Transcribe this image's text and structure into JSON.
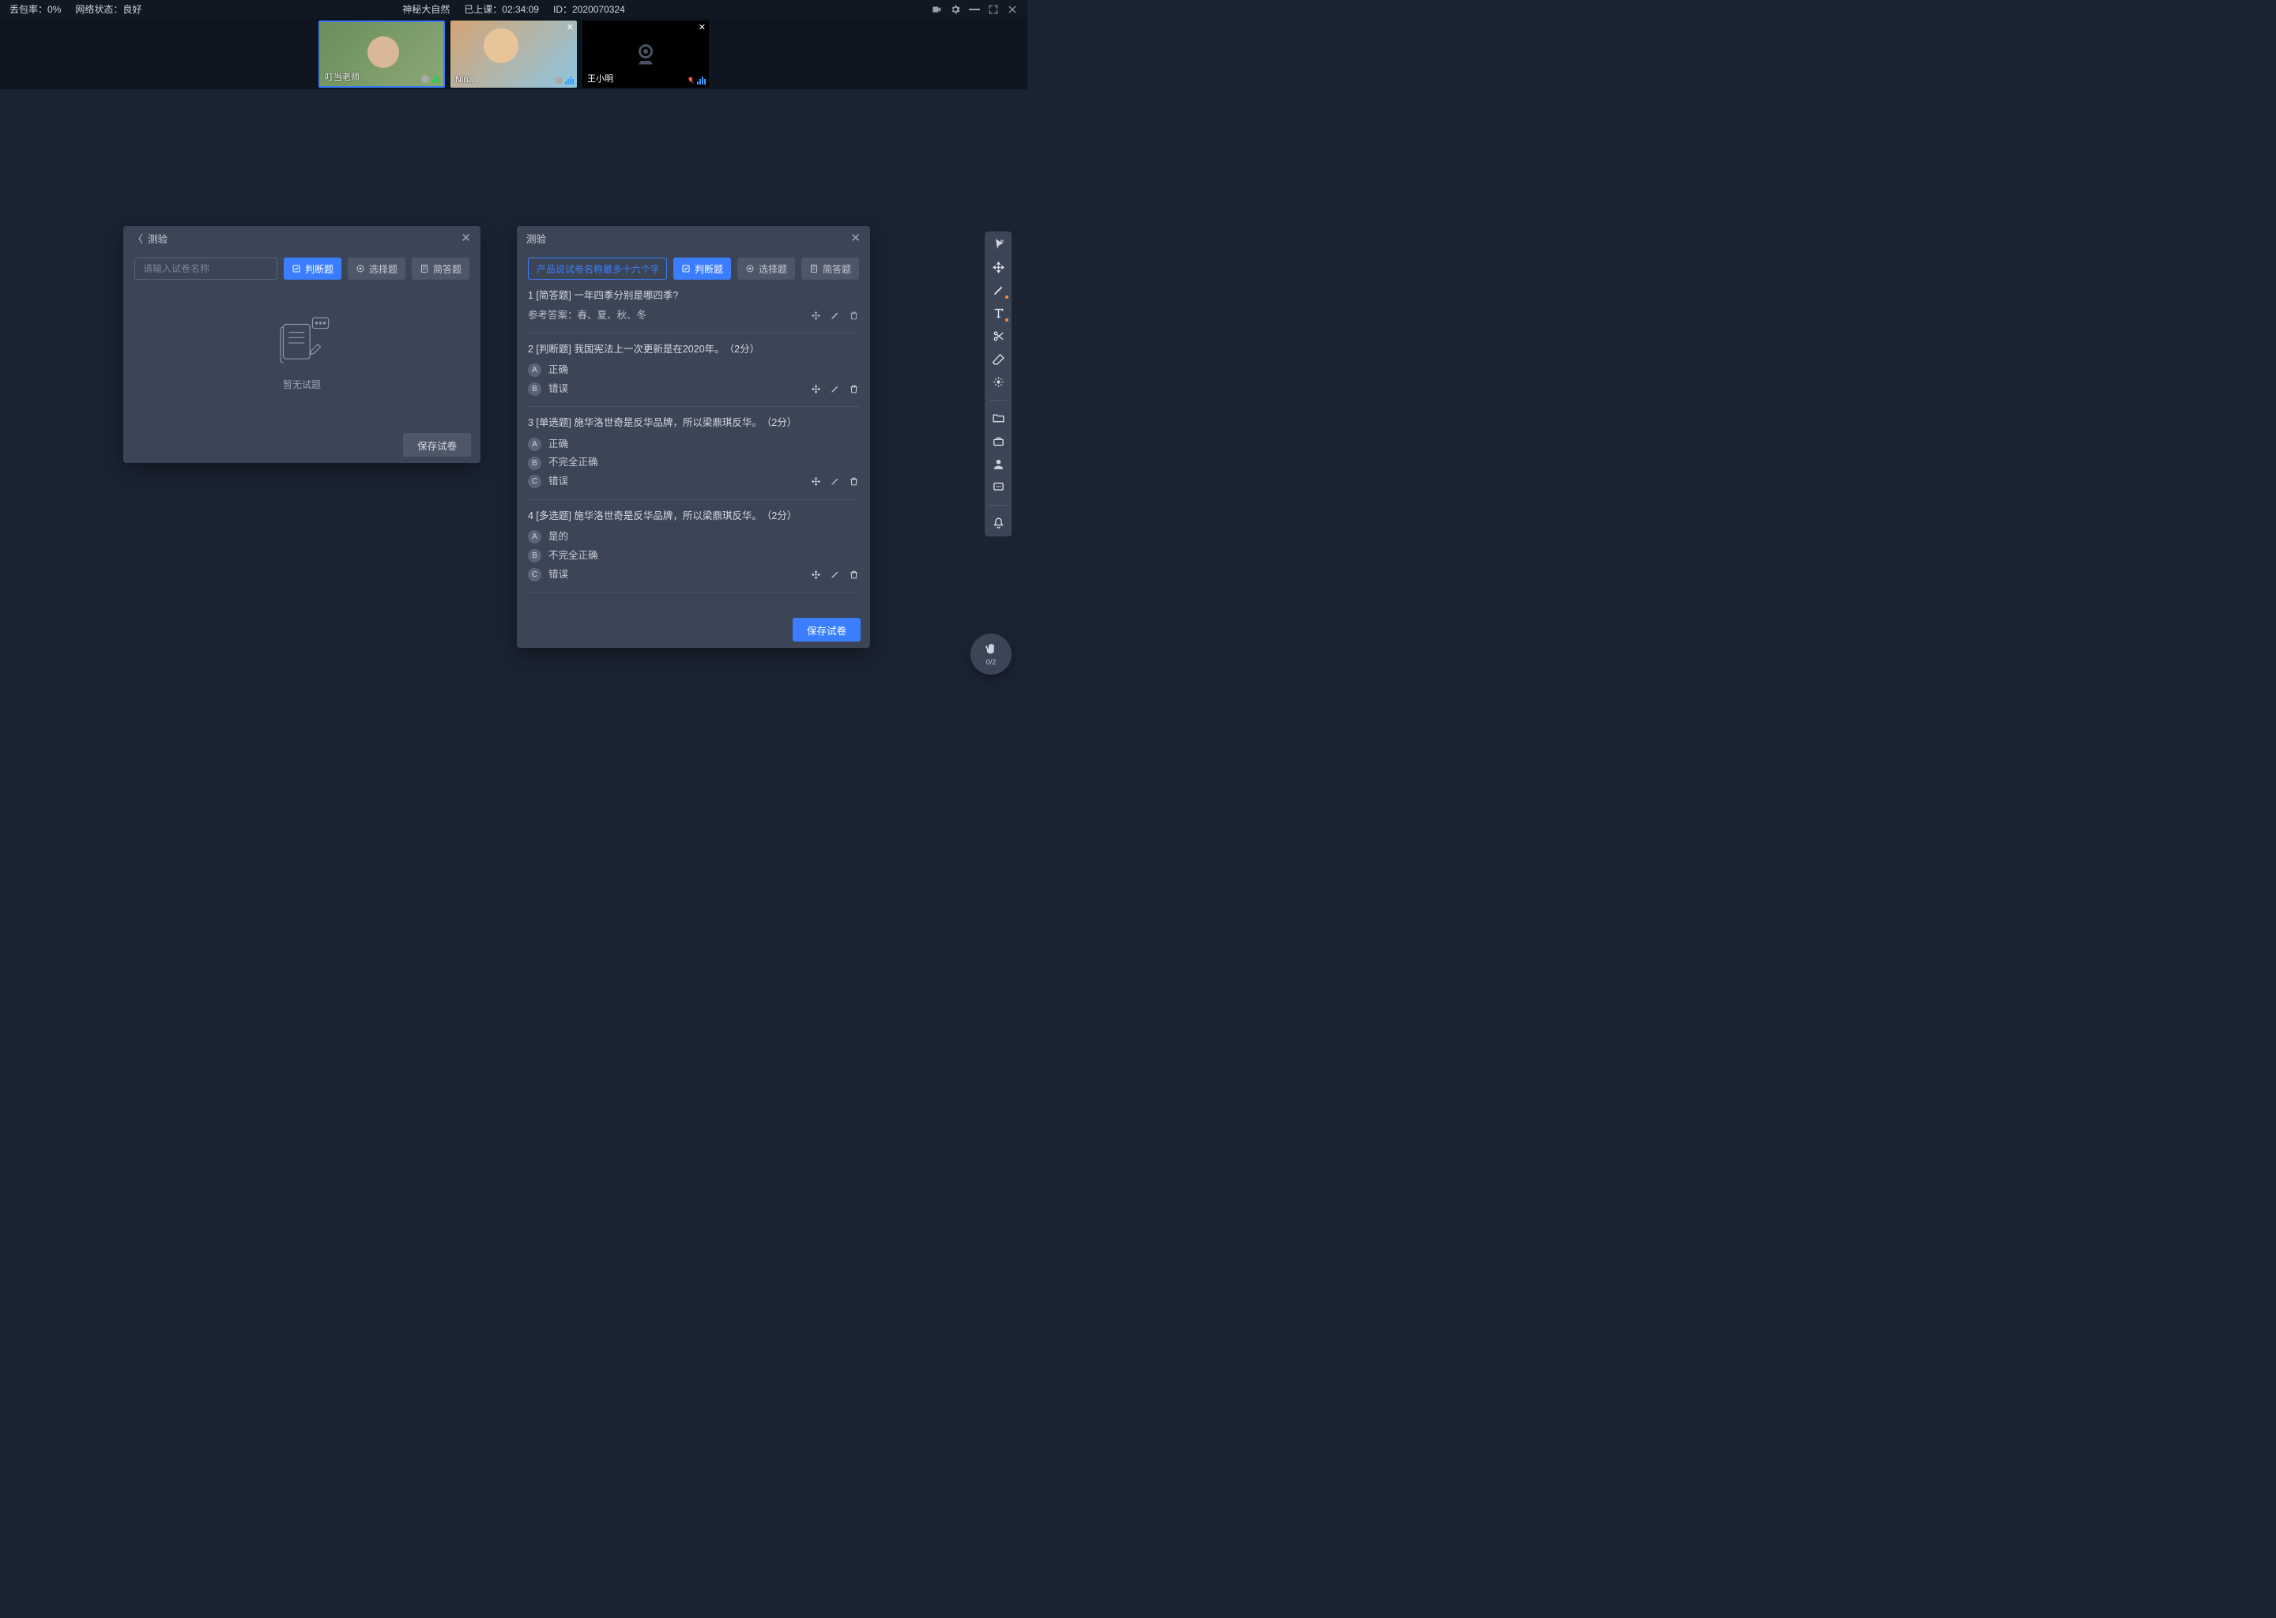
{
  "topbar": {
    "loss_rate_label": "丢包率：",
    "loss_rate_value": "0%",
    "network_label": "网络状态：",
    "network_value": "良好",
    "lesson_title": "神秘大自然",
    "duration_label": "已上课：",
    "duration_value": "02:34:09",
    "id_label": "ID：",
    "id_value": "2020070324"
  },
  "participants": [
    {
      "name": "叮当老师",
      "role": "teacher",
      "camera": "on"
    },
    {
      "name": "Nina",
      "role": "student",
      "camera": "on"
    },
    {
      "name": "王小明",
      "role": "student",
      "camera": "off"
    }
  ],
  "panelLeft": {
    "title": "测验",
    "name_placeholder": "请输入试卷名称",
    "btn_judge": "判断题",
    "btn_choice": "选择题",
    "btn_short": "简答题",
    "empty_text": "暂无试题",
    "save": "保存试卷"
  },
  "panelRight": {
    "title": "测验",
    "name_value": "产品说试卷名称最多十六个字",
    "btn_judge": "判断题",
    "btn_choice": "选择题",
    "btn_short": "简答题",
    "save": "保存试卷",
    "questions": [
      {
        "num": "1",
        "tag": "[简答题]",
        "text": "一年四季分别是哪四季?",
        "answer_label": "参考答案：",
        "answer": "春、夏、秋、冬"
      },
      {
        "num": "2",
        "tag": "[判断题]",
        "text": "我国宪法上一次更新是在2020年。",
        "score": "（2分）",
        "options": [
          {
            "k": "A",
            "v": "正确"
          },
          {
            "k": "B",
            "v": "错误"
          }
        ]
      },
      {
        "num": "3",
        "tag": "[单选题]",
        "text": "施华洛世奇是反华品牌，所以梁鼎琪反华。",
        "score": "（2分）",
        "options": [
          {
            "k": "A",
            "v": "正确"
          },
          {
            "k": "B",
            "v": "不完全正确"
          },
          {
            "k": "C",
            "v": "错误"
          }
        ]
      },
      {
        "num": "4",
        "tag": "[多选题]",
        "text": "施华洛世奇是反华品牌，所以梁鼎琪反华。",
        "score": "（2分）",
        "options": [
          {
            "k": "A",
            "v": "是的"
          },
          {
            "k": "B",
            "v": "不完全正确"
          },
          {
            "k": "C",
            "v": "错误"
          }
        ]
      }
    ]
  },
  "hand": {
    "count": "0/2"
  }
}
